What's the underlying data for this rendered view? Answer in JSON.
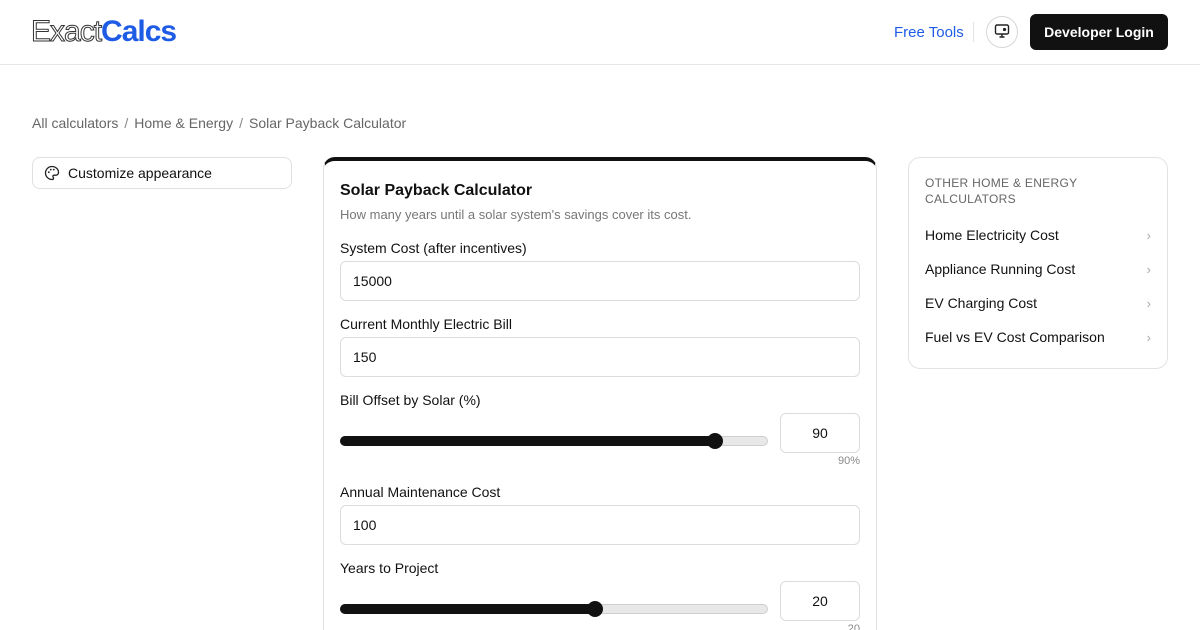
{
  "header": {
    "logo_thin": "Exact",
    "logo_bold": "Calcs",
    "free_tools": "Free Tools",
    "theme_icon": "monitor-icon",
    "login": "Developer Login"
  },
  "breadcrumb": {
    "items": [
      "All calculators",
      "Home & Energy",
      "Solar Payback Calculator"
    ],
    "separator": "/"
  },
  "customize": {
    "icon": "palette-icon",
    "label": "Customize appearance"
  },
  "calculator": {
    "title": "Solar Payback Calculator",
    "subtitle": "How many years until a solar system's savings cover its cost.",
    "fields": {
      "system_cost": {
        "label": "System Cost (after incentives)",
        "value": "15000"
      },
      "monthly_bill": {
        "label": "Current Monthly Electric Bill",
        "value": "150"
      },
      "bill_offset": {
        "label": "Bill Offset by Solar (%)",
        "value": "90",
        "caption": "90%",
        "fraction": 0.875
      },
      "maintenance": {
        "label": "Annual Maintenance Cost",
        "value": "100"
      },
      "years": {
        "label": "Years to Project",
        "value": "20",
        "caption": "20",
        "fraction": 0.595
      }
    }
  },
  "sidebar": {
    "heading": "Other Home & Energy Calculators",
    "items": [
      {
        "label": "Home Electricity Cost"
      },
      {
        "label": "Appliance Running Cost"
      },
      {
        "label": "EV Charging Cost"
      },
      {
        "label": "Fuel vs EV Cost Comparison"
      }
    ],
    "chevron": "›"
  },
  "colors": {
    "brand": "#1f5ce6",
    "dark": "#111111",
    "muted": "#777777"
  }
}
